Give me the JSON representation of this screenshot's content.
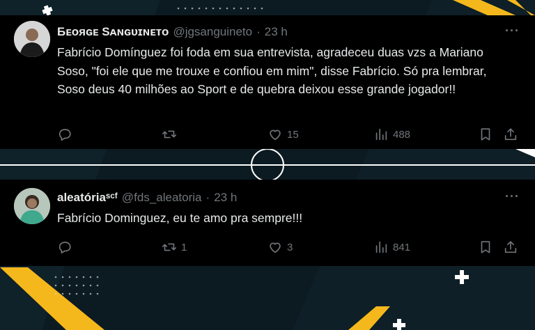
{
  "colors": {
    "background": "#0c1a22",
    "accent_yellow": "#f5b81c",
    "tweet_bg": "#000000",
    "text": "#e7e9ea",
    "muted": "#71767b"
  },
  "tweets": [
    {
      "display_name": "Ƃᴇᴏяɢᴇ Sᴀɴɢᴜɪɴᴇᴛᴏ",
      "handle": "@jgsanguineto",
      "separator": "·",
      "time": "23 h",
      "text": "Fabrício Domínguez foi foda em sua entrevista, agradeceu duas vzs a Mariano Soso, \"foi ele que me trouxe e confiou em mim\", disse Fabrício. Só pra lembrar, Soso deus 40 milhões ao Sport e de quebra deixou esse grande jogador!!",
      "replies": "",
      "reposts": "",
      "likes": "15",
      "views": "488",
      "avatar_icon": "person-avatar-icon"
    },
    {
      "display_name": "aleatóriaˢᶜᶠ",
      "handle": "@fds_aleatoria",
      "separator": "·",
      "time": "23 h",
      "text": "Fabrício Dominguez, eu te amo pra sempre!!!",
      "replies": "",
      "reposts": "1",
      "likes": "3",
      "views": "841",
      "avatar_icon": "person-avatar-icon"
    }
  ],
  "icons": {
    "more": "more-icon",
    "reply": "reply-icon",
    "repost": "repost-icon",
    "like": "heart-icon",
    "views": "views-icon",
    "bookmark": "bookmark-icon",
    "share": "share-icon"
  },
  "more_glyph": "···"
}
